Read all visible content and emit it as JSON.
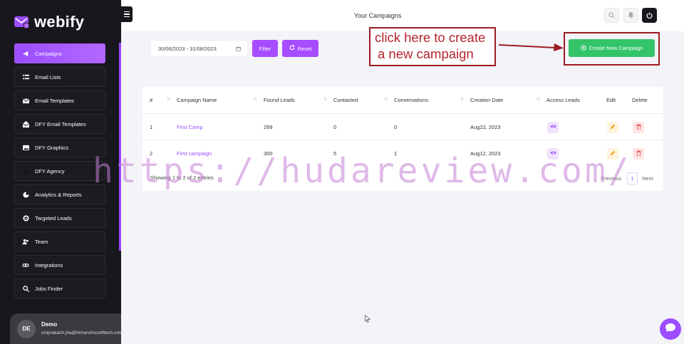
{
  "app": {
    "name": "webify"
  },
  "sidebar": {
    "items": [
      {
        "label": "Campaigns",
        "icon": "megaphone-icon",
        "active": true
      },
      {
        "label": "Email Lists",
        "icon": "list-icon",
        "active": false
      },
      {
        "label": "Email Templates",
        "icon": "envelope-icon",
        "active": false
      },
      {
        "label": "DFY Email Templates",
        "icon": "envelope-open-icon",
        "active": false
      },
      {
        "label": "DFY Graphics",
        "icon": "image-icon",
        "active": false
      },
      {
        "label": "DFY Agency",
        "icon": "briefcase-icon",
        "active": false
      },
      {
        "label": "Analytics & Reports",
        "icon": "pie-chart-icon",
        "active": false
      },
      {
        "label": "Targeted Leads",
        "icon": "target-icon",
        "active": false
      },
      {
        "label": "Team",
        "icon": "users-icon",
        "active": false
      },
      {
        "label": "Integrations",
        "icon": "link-icon",
        "active": false
      },
      {
        "label": "Jobs Finder",
        "icon": "search-icon",
        "active": false
      }
    ],
    "user": {
      "initials": "DE",
      "name": "Demo",
      "email": "omprakash.jha@himanshusofttech.com"
    }
  },
  "header": {
    "title": "Your Campaigns"
  },
  "filters": {
    "date_range": "30/06/2023 - 31/08/2023",
    "filter_label": "Filter",
    "reset_label": "Reset"
  },
  "annotation": {
    "line1": "click here to create",
    "line2": "a new campaign"
  },
  "create_button": {
    "label": "Create New Campaign"
  },
  "table": {
    "headers": [
      "#",
      "Campaign Name",
      "Found Leads",
      "Contacted",
      "Conversations",
      "Creation Date",
      "Access Leads",
      "Edit",
      "Delete"
    ],
    "rows": [
      {
        "index": "1",
        "name": "First Camp",
        "found": "299",
        "contacted": "0",
        "conversations": "0",
        "date": "Aug22, 2023"
      },
      {
        "index": "2",
        "name": "First campaign",
        "found": "300",
        "contacted": "5",
        "conversations": "1",
        "date": "Aug12, 2023"
      }
    ],
    "footer": "Showing 1 to 2 of 2 entries",
    "pagination": {
      "previous": "Previous",
      "page": "1",
      "next": "Next"
    }
  },
  "watermark": "https://hudareview.com/",
  "colors": {
    "accent": "#9b4dff",
    "success": "#33c46a",
    "annotation": "#b3242d",
    "sidebar": "#17171d"
  }
}
